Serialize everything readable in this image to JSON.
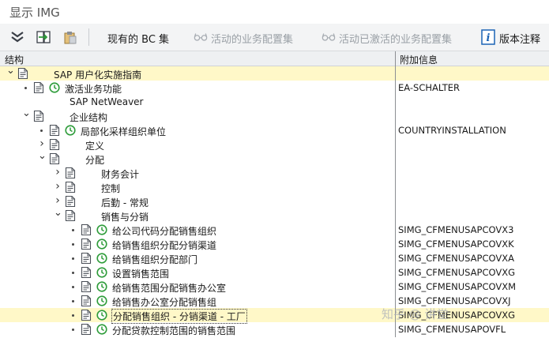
{
  "window": {
    "title": "显示 IMG"
  },
  "toolbar": {
    "existing_bc": "现有的 BC 集",
    "active_bc": "活动的业务配置集",
    "activated_bc": "活动已激活的业务配置集",
    "release_notes": "版本注释"
  },
  "columns": {
    "structure": "结构",
    "additional_info": "附加信息"
  },
  "tree": [
    {
      "label": "SAP 用户化实施指南",
      "info": ""
    },
    {
      "label": "激活业务功能",
      "info": "EA-SCHALTER"
    },
    {
      "label": "SAP NetWeaver",
      "info": ""
    },
    {
      "label": "企业结构",
      "info": ""
    },
    {
      "label": "局部化采样组织单位",
      "info": "COUNTRYINSTALLATION"
    },
    {
      "label": "定义",
      "info": ""
    },
    {
      "label": "分配",
      "info": ""
    },
    {
      "label": "财务会计",
      "info": ""
    },
    {
      "label": "控制",
      "info": ""
    },
    {
      "label": "后勤 - 常规",
      "info": ""
    },
    {
      "label": "销售与分销",
      "info": ""
    },
    {
      "label": "给公司代码分配销售组织",
      "info": "SIMG_CFMENUSAPCOVX3"
    },
    {
      "label": "给销售组织分配分销渠道",
      "info": "SIMG_CFMENUSAPCOVXK"
    },
    {
      "label": "给销售组织分配部门",
      "info": "SIMG_CFMENUSAPCOVXA"
    },
    {
      "label": "设置销售范围",
      "info": "SIMG_CFMENUSAPCOVXG"
    },
    {
      "label": "给销售范围分配销售办公室",
      "info": "SIMG_CFMENUSAPCOVXM"
    },
    {
      "label": "给销售办公室分配销售组",
      "info": "SIMG_CFMENUSAPCOVXJ"
    },
    {
      "label": "分配销售组织 - 分销渠道 - 工厂",
      "info": "SIMG_CFMENUSAPCOVXG"
    },
    {
      "label": "分配贷款控制范围的销售范围",
      "info": "SIMG_CFMENUSAPOVFL"
    }
  ],
  "watermark": "知乎 @ 讲堂",
  "colors": {
    "highlight": "#fff8c8",
    "clock_green": "#2e9c3a",
    "info_blue": "#1b63b5"
  }
}
